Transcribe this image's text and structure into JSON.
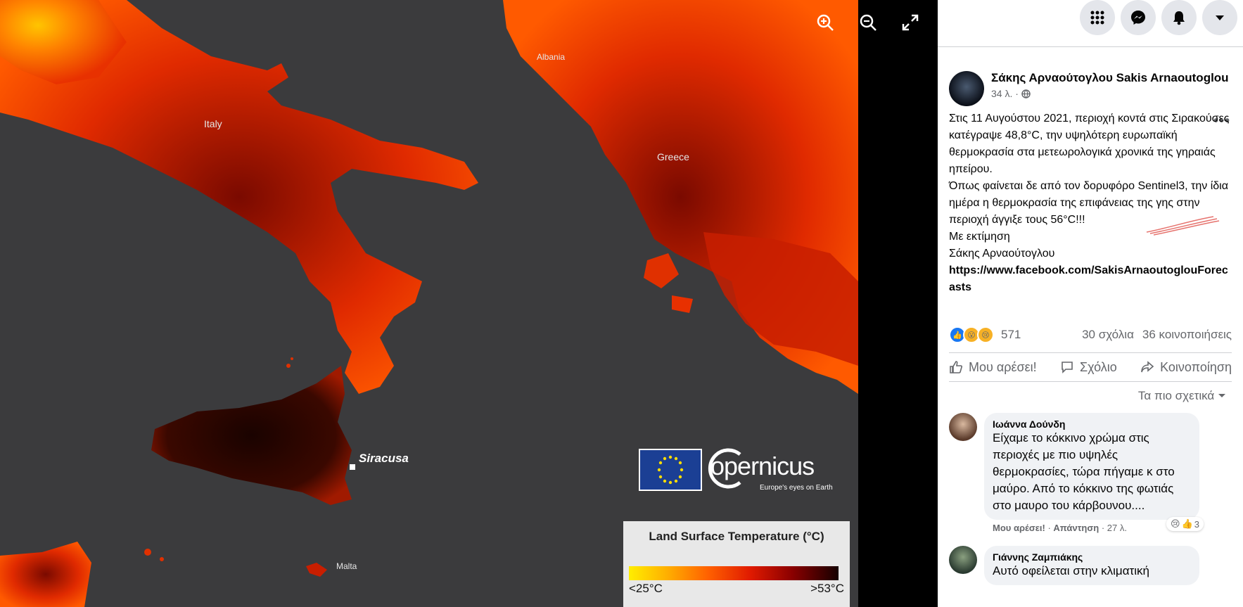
{
  "map": {
    "labels": {
      "italy": "Italy",
      "albania": "Albania",
      "greece": "Greece",
      "siracusa": "Siracusa",
      "malta": "Malta"
    },
    "copernicus": {
      "wordmark": "opernicus",
      "tagline": "Europe's eyes on Earth"
    },
    "legend": {
      "title": "Land Surface Temperature (°C)",
      "min": "<25°C",
      "max": ">53°C"
    },
    "controls": [
      "zoom-in-icon",
      "zoom-out-icon",
      "fullscreen-icon"
    ]
  },
  "colors": {
    "fb_blue": "#1877f2",
    "sea": "#3b3b3d",
    "secondary_text": "#65676b"
  },
  "post": {
    "author": "Σάκης Αρναούτογλου Sakis Arnaoutoglou",
    "time": "34 λ. ·",
    "body_lines": [
      "Στις 11 Αυγούστου 2021, περιοχή κοντά στις Σιρακούσες κατέγραψε 48,8°C, την υψηλότερη ευρωπαϊκή θερμοκρασία στα μετεωρολογικά χρονικά της γηραιάς ηπείρου.",
      "Όπως φαίνεται δε από τον δορυφόρο Sentinel3, την ίδια ημέρα η θερμοκρασία της επιφάνειας της γης στην περιοχή άγγιξε τους 56°C!!!",
      "Με εκτίμηση",
      "Σάκης Αρναούτογλου"
    ],
    "link": "https://www.facebook.com/SakisArnaoutoglouForecasts",
    "reactions_count": "571",
    "comments_count": "30 σχόλια",
    "shares_count": "36 κοινοποιήσεις",
    "actions": {
      "like": "Μου αρέσει!",
      "comment": "Σχόλιο",
      "share": "Κοινοποίηση"
    },
    "sort_label": "Τα πιο σχετικά"
  },
  "comments": [
    {
      "name": "Ιωάννα Δούνδη",
      "text": "Είχαμε το κόκκινο χρώμα στις περιοχές με πιο υψηλές θερμοκρασίες, τώρα πήγαμε κ στο μαύρο. Από το κόκκινο της φωτιάς στο μαυρο του κάρβουνου....",
      "like_label": "Μου αρέσει!",
      "reply_label": "Απάντηση",
      "time": "· 27 λ.",
      "reactions": "3"
    },
    {
      "name": "Γιάννης Ζαμπιάκης",
      "text": "Αυτό οφείλεται στην κλιματική"
    }
  ]
}
